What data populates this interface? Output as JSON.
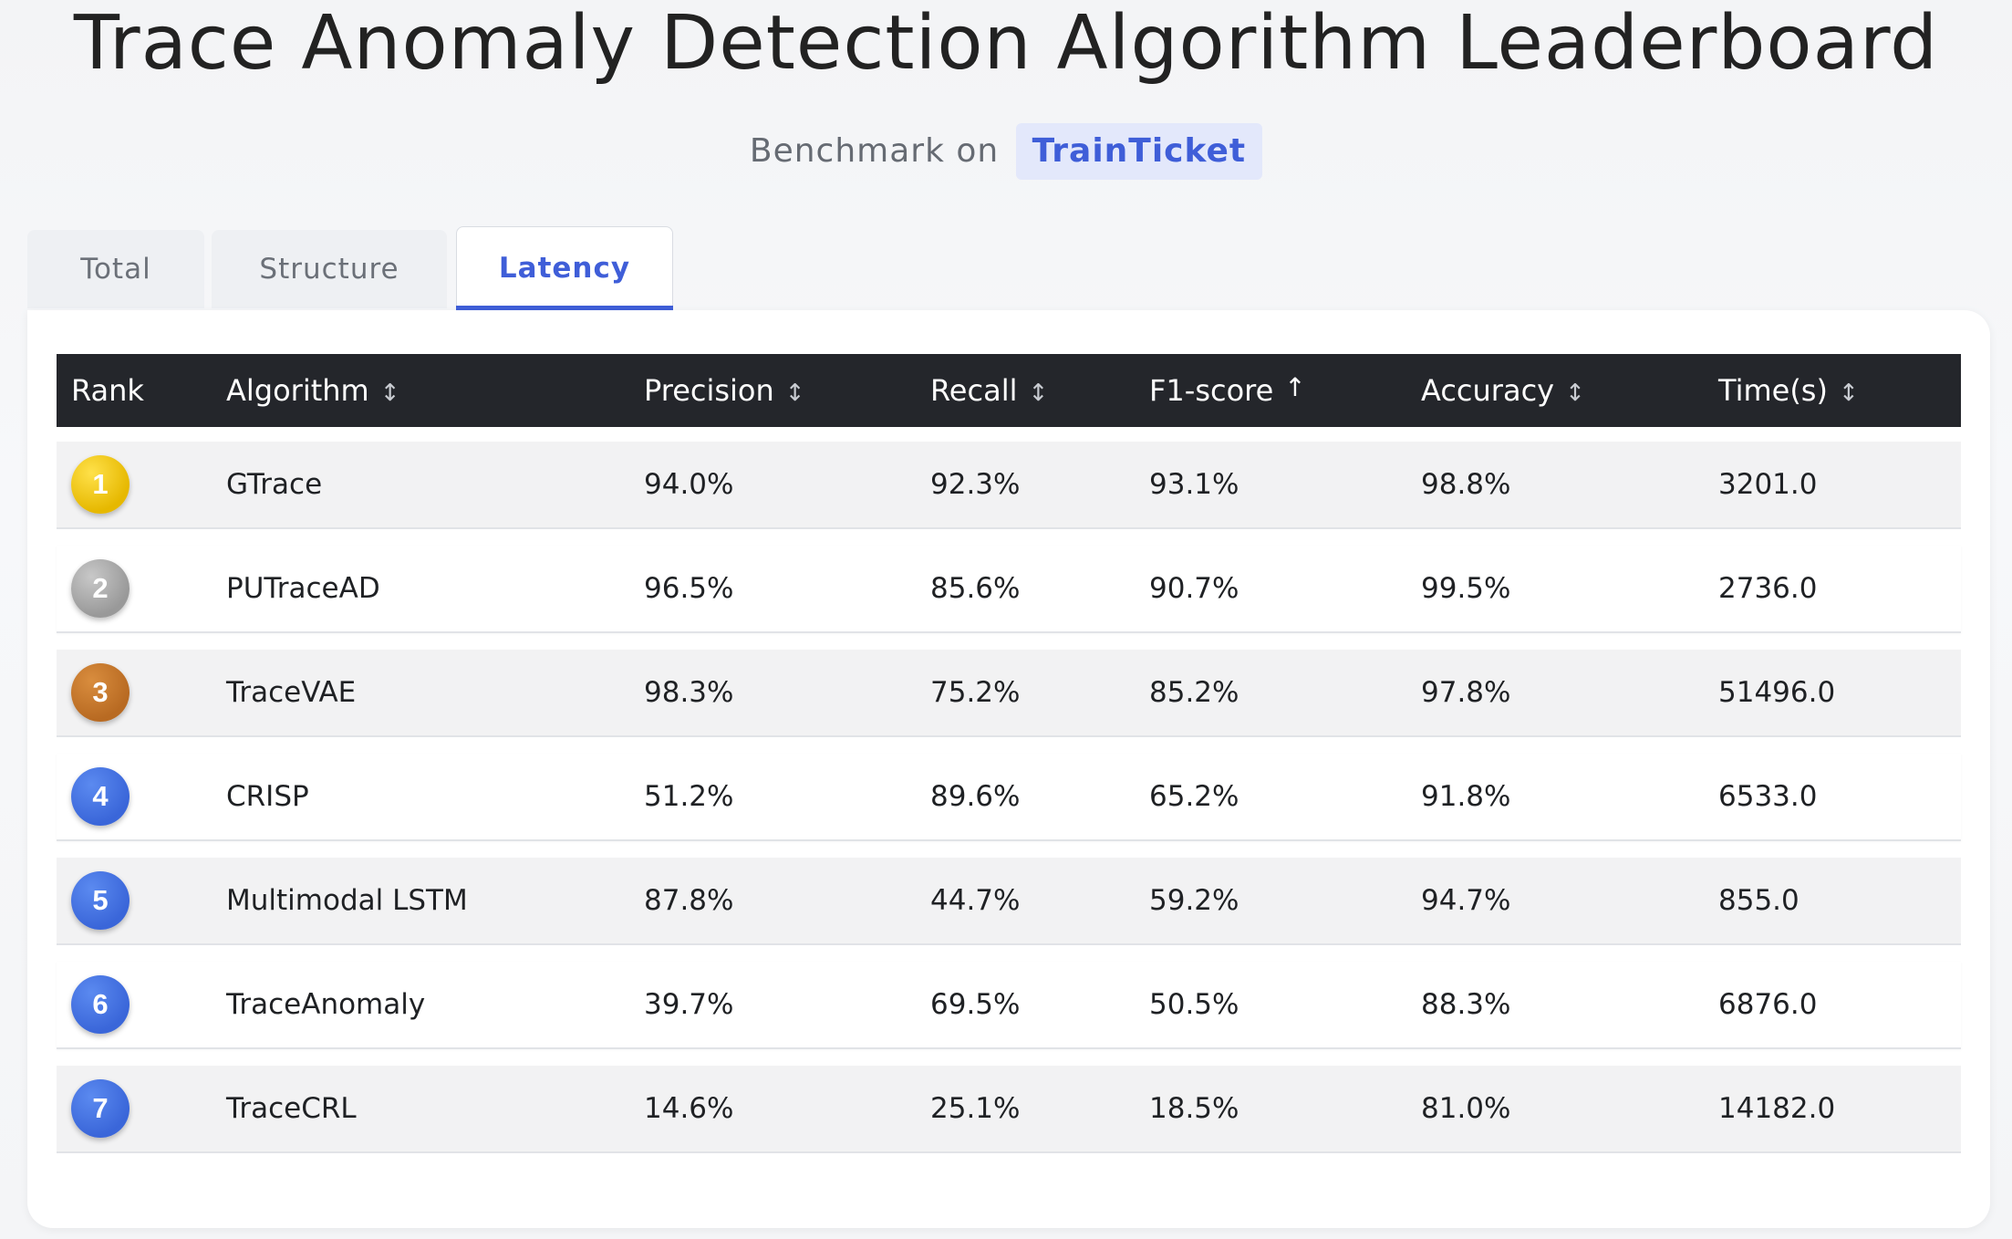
{
  "header": {
    "title": "Trace Anomaly Detection Algorithm Leaderboard",
    "subtitle_prefix": "Benchmark on",
    "dataset": "TrainTicket"
  },
  "tabs": [
    {
      "label": "Total",
      "active": false
    },
    {
      "label": "Structure",
      "active": false
    },
    {
      "label": "Latency",
      "active": true
    }
  ],
  "table": {
    "columns": [
      {
        "label": "Rank",
        "sort_icon": ""
      },
      {
        "label": "Algorithm",
        "sort_icon": "↕"
      },
      {
        "label": "Precision",
        "sort_icon": "↕"
      },
      {
        "label": "Recall",
        "sort_icon": "↕"
      },
      {
        "label": "F1-score",
        "sort_icon": "↑"
      },
      {
        "label": "Accuracy",
        "sort_icon": "↕"
      },
      {
        "label": "Time(s)",
        "sort_icon": "↕"
      }
    ],
    "rows": [
      {
        "rank": "1",
        "algorithm": "GTrace",
        "precision": "94.0%",
        "recall": "92.3%",
        "f1": "93.1%",
        "accuracy": "98.8%",
        "time": "3201.0"
      },
      {
        "rank": "2",
        "algorithm": "PUTraceAD",
        "precision": "96.5%",
        "recall": "85.6%",
        "f1": "90.7%",
        "accuracy": "99.5%",
        "time": "2736.0"
      },
      {
        "rank": "3",
        "algorithm": "TraceVAE",
        "precision": "98.3%",
        "recall": "75.2%",
        "f1": "85.2%",
        "accuracy": "97.8%",
        "time": "51496.0"
      },
      {
        "rank": "4",
        "algorithm": "CRISP",
        "precision": "51.2%",
        "recall": "89.6%",
        "f1": "65.2%",
        "accuracy": "91.8%",
        "time": "6533.0"
      },
      {
        "rank": "5",
        "algorithm": "Multimodal LSTM",
        "precision": "87.8%",
        "recall": "44.7%",
        "f1": "59.2%",
        "accuracy": "94.7%",
        "time": "855.0"
      },
      {
        "rank": "6",
        "algorithm": "TraceAnomaly",
        "precision": "39.7%",
        "recall": "69.5%",
        "f1": "50.5%",
        "accuracy": "88.3%",
        "time": "6876.0"
      },
      {
        "rank": "7",
        "algorithm": "TraceCRL",
        "precision": "14.6%",
        "recall": "25.1%",
        "f1": "18.5%",
        "accuracy": "81.0%",
        "time": "14182.0"
      }
    ]
  },
  "colors": {
    "accent": "#3f5ed8",
    "header_bg": "#24262b",
    "gold": "#e8bf00",
    "silver": "#a6a6a6",
    "bronze": "#c0762a",
    "blue_badge": "#3f6fe0"
  }
}
